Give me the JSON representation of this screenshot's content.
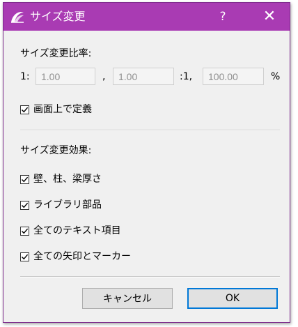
{
  "window": {
    "title": "サイズ変更",
    "help_glyph": "?",
    "close_glyph": "✕",
    "colors": {
      "titlebar": "#a93bb3",
      "default_button_border": "#0078d7"
    }
  },
  "scale": {
    "section_label": "サイズ変更比率:",
    "prefix": "1:",
    "separator": ",",
    "ratio_prefix": ":1,",
    "unit": "%",
    "value_1": "1.00",
    "value_2": "1.00",
    "percent": "100.00"
  },
  "options": {
    "on_screen_define": {
      "label": "画面上で定義",
      "checked": true
    }
  },
  "effects": {
    "section_label": "サイズ変更効果:",
    "items": [
      {
        "label": "壁、柱、梁厚さ",
        "checked": true
      },
      {
        "label": "ライブラリ部品",
        "checked": true
      },
      {
        "label": "全てのテキスト項目",
        "checked": true
      },
      {
        "label": "全ての矢印とマーカー",
        "checked": true
      }
    ]
  },
  "buttons": {
    "cancel": "キャンセル",
    "ok": "OK"
  }
}
